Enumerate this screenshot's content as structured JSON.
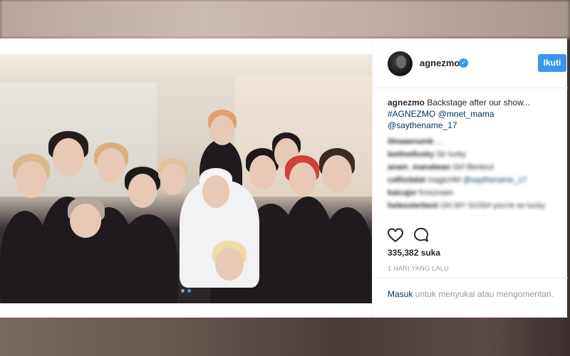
{
  "post": {
    "username": "agnezmo",
    "follow_label": "Ikuti",
    "caption": {
      "username": "agnezmo",
      "text": " Backstage after our show...",
      "hashtag": "#AGNEZMO",
      "mention_1": "@mnet_mama",
      "mention_2": "@saythename_17"
    },
    "comments": [
      {
        "user": "lilnaaenumb",
        "text": "...",
        "mention": ""
      },
      {
        "user": "leelinellusky",
        "text": "Sir lucky",
        "mention": ""
      },
      {
        "user": "anam_manalwan",
        "text": "Girl Bentoul",
        "mention": ""
      },
      {
        "user": "caflizdalat",
        "text": "magicHM",
        "mention": "@saythename_17"
      },
      {
        "user": "kaicajer",
        "text": "fcrezmam",
        "mention": ""
      },
      {
        "user": "helessterbest",
        "text": "OH MY GOSH you're so lucky",
        "mention": ""
      }
    ],
    "likes": "335,382 suka",
    "time": "1 HARI YANG LALU",
    "login": {
      "link": "Masuk",
      "text": " untuk menyukai atau mengomentari."
    }
  },
  "icons": {
    "like": "heart-icon",
    "comment": "comment-icon",
    "verified": "verified-badge-icon"
  },
  "colors": {
    "accent": "#3897f0",
    "link": "#003569",
    "muted": "#999999"
  }
}
